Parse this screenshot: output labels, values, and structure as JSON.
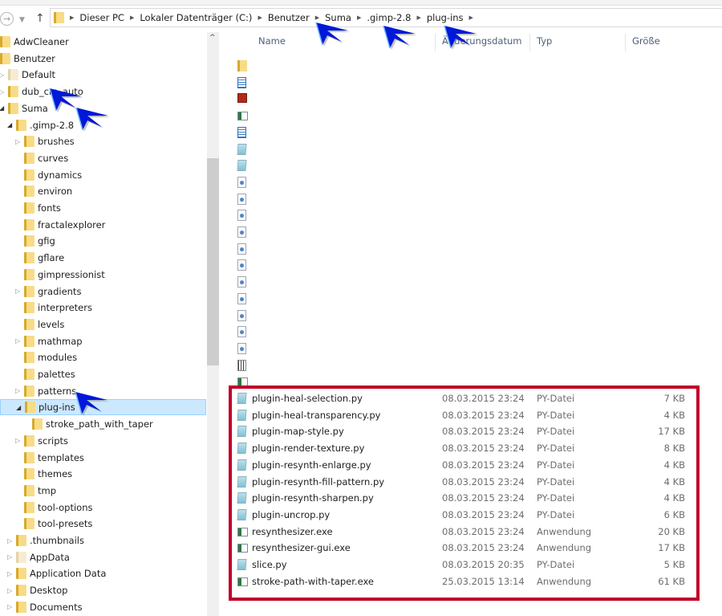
{
  "address_bar": {
    "crumbs": [
      "Dieser PC",
      "Lokaler Datenträger (C:)",
      "Benutzer",
      "Suma",
      ".gimp-2.8",
      "plug-ins"
    ]
  },
  "nav": {
    "back_icon": "back-arrow-icon",
    "recent_icon": "chevron-down-icon",
    "up_icon": "up-arrow-icon"
  },
  "tree": [
    {
      "label": "AdwCleaner",
      "level": 0,
      "exp": "none"
    },
    {
      "label": "Benutzer",
      "level": 0,
      "exp": "none"
    },
    {
      "label": "Default",
      "level": 1,
      "exp": "collapsed",
      "pale": true
    },
    {
      "label": "dub_cm_auto",
      "level": 1,
      "exp": "collapsed"
    },
    {
      "label": "Suma",
      "level": 1,
      "exp": "expanded"
    },
    {
      "label": ".gimp-2.8",
      "level": 2,
      "exp": "expanded"
    },
    {
      "label": "brushes",
      "level": 3,
      "exp": "collapsed"
    },
    {
      "label": "curves",
      "level": 3,
      "exp": "none"
    },
    {
      "label": "dynamics",
      "level": 3,
      "exp": "none"
    },
    {
      "label": "environ",
      "level": 3,
      "exp": "none"
    },
    {
      "label": "fonts",
      "level": 3,
      "exp": "none"
    },
    {
      "label": "fractalexplorer",
      "level": 3,
      "exp": "none"
    },
    {
      "label": "gfig",
      "level": 3,
      "exp": "none"
    },
    {
      "label": "gflare",
      "level": 3,
      "exp": "none"
    },
    {
      "label": "gimpressionist",
      "level": 3,
      "exp": "none"
    },
    {
      "label": "gradients",
      "level": 3,
      "exp": "collapsed"
    },
    {
      "label": "interpreters",
      "level": 3,
      "exp": "none"
    },
    {
      "label": "levels",
      "level": 3,
      "exp": "none"
    },
    {
      "label": "mathmap",
      "level": 3,
      "exp": "collapsed"
    },
    {
      "label": "modules",
      "level": 3,
      "exp": "none"
    },
    {
      "label": "palettes",
      "level": 3,
      "exp": "none"
    },
    {
      "label": "patterns",
      "level": 3,
      "exp": "collapsed"
    },
    {
      "label": "plug-ins",
      "level": 3,
      "exp": "expanded",
      "selected": true
    },
    {
      "label": "stroke_path_with_taper",
      "level": 4,
      "exp": "none"
    },
    {
      "label": "scripts",
      "level": 3,
      "exp": "collapsed"
    },
    {
      "label": "templates",
      "level": 3,
      "exp": "none"
    },
    {
      "label": "themes",
      "level": 3,
      "exp": "none"
    },
    {
      "label": "tmp",
      "level": 3,
      "exp": "none"
    },
    {
      "label": "tool-options",
      "level": 3,
      "exp": "none"
    },
    {
      "label": "tool-presets",
      "level": 3,
      "exp": "none"
    },
    {
      "label": ".thumbnails",
      "level": 2,
      "exp": "collapsed"
    },
    {
      "label": "AppData",
      "level": 2,
      "exp": "collapsed",
      "pale": true
    },
    {
      "label": "Application Data",
      "level": 2,
      "exp": "collapsed"
    },
    {
      "label": "Desktop",
      "level": 2,
      "exp": "collapsed"
    },
    {
      "label": "Documents",
      "level": 2,
      "exp": "collapsed"
    }
  ],
  "columns": {
    "name": "Name",
    "date": "Änderungsdatum",
    "type": "Typ",
    "size": "Größe"
  },
  "hidden_rows_icons": [
    "folder",
    "doc",
    "red",
    "exe",
    "doc",
    "py",
    "py",
    "gear",
    "gear",
    "gear",
    "gear",
    "gear",
    "gear",
    "gear",
    "gear",
    "gear",
    "gear",
    "gear",
    "special",
    "exe"
  ],
  "files": [
    {
      "name": "plugin-heal-selection.py",
      "date": "08.03.2015 23:24",
      "type": "PY-Datei",
      "size": "7 KB",
      "icon": "py"
    },
    {
      "name": "plugin-heal-transparency.py",
      "date": "08.03.2015 23:24",
      "type": "PY-Datei",
      "size": "4 KB",
      "icon": "py"
    },
    {
      "name": "plugin-map-style.py",
      "date": "08.03.2015 23:24",
      "type": "PY-Datei",
      "size": "17 KB",
      "icon": "py"
    },
    {
      "name": "plugin-render-texture.py",
      "date": "08.03.2015 23:24",
      "type": "PY-Datei",
      "size": "8 KB",
      "icon": "py"
    },
    {
      "name": "plugin-resynth-enlarge.py",
      "date": "08.03.2015 23:24",
      "type": "PY-Datei",
      "size": "4 KB",
      "icon": "py"
    },
    {
      "name": "plugin-resynth-fill-pattern.py",
      "date": "08.03.2015 23:24",
      "type": "PY-Datei",
      "size": "4 KB",
      "icon": "py"
    },
    {
      "name": "plugin-resynth-sharpen.py",
      "date": "08.03.2015 23:24",
      "type": "PY-Datei",
      "size": "4 KB",
      "icon": "py"
    },
    {
      "name": "plugin-uncrop.py",
      "date": "08.03.2015 23:24",
      "type": "PY-Datei",
      "size": "6 KB",
      "icon": "py"
    },
    {
      "name": "resynthesizer.exe",
      "date": "08.03.2015 23:24",
      "type": "Anwendung",
      "size": "20 KB",
      "icon": "exe"
    },
    {
      "name": "resynthesizer-gui.exe",
      "date": "08.03.2015 23:24",
      "type": "Anwendung",
      "size": "17 KB",
      "icon": "exe"
    },
    {
      "name": "slice.py",
      "date": "08.03.2015 20:35",
      "type": "PY-Datei",
      "size": "5 KB",
      "icon": "py"
    },
    {
      "name": "stroke-path-with-taper.exe",
      "date": "25.03.2015 13:14",
      "type": "Anwendung",
      "size": "61 KB",
      "icon": "exe"
    }
  ],
  "colors": {
    "highlight_box": "#c0002a",
    "selection": "#cce8ff",
    "annotation_arrow": "#0018d8"
  }
}
